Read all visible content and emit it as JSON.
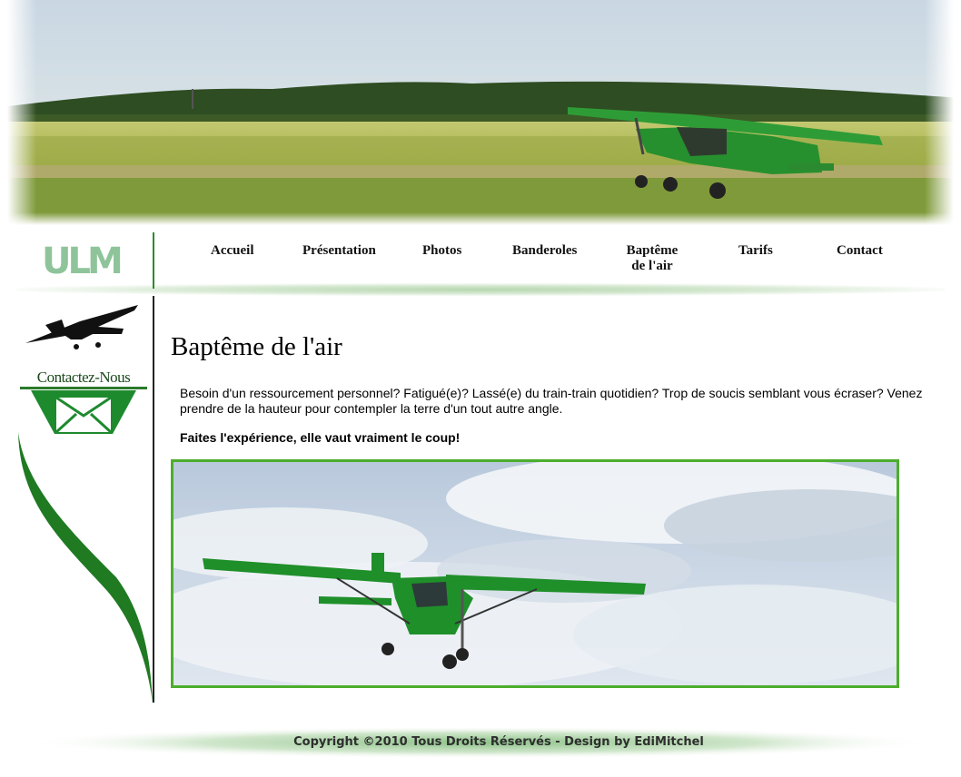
{
  "nav": {
    "items": [
      {
        "label": "Accueil"
      },
      {
        "label": "Présentation"
      },
      {
        "label": "Photos"
      },
      {
        "label": "Banderoles"
      },
      {
        "label": "Baptême"
      },
      {
        "label": "Tarifs"
      },
      {
        "label": "Contact"
      }
    ],
    "bapteme_line2": "de l'air"
  },
  "logo": {
    "text": "ULM"
  },
  "sidebar": {
    "contact_label": "Contactez-Nous"
  },
  "main": {
    "title": "Baptême de l'air",
    "intro": "Besoin d'un ressourcement personnel? Fatigué(e)? Lassé(e) du train-train quotidien? Trop de soucis semblant vous écraser? Venez prendre de la hauteur pour contempler la terre d'un tout autre angle.",
    "tagline": "Faites l'expérience, elle vaut vraiment le coup!"
  },
  "footer": {
    "text": "Copyright ©2010 Tous Droits Réservés - Design by EdiMitchel"
  },
  "colors": {
    "accent_green": "#4cae2c",
    "plane_green": "#1f8f2a"
  }
}
